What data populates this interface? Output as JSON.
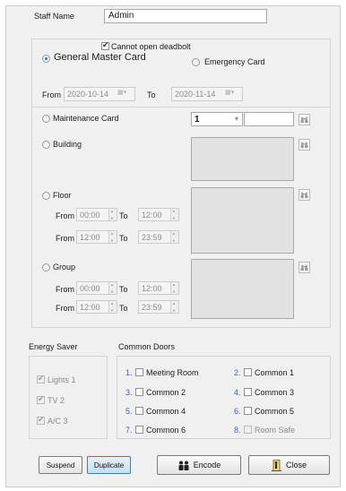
{
  "staff": {
    "label": "Staff Name",
    "value": "Admin"
  },
  "card_type": {
    "cannot_open_deadbolt": "Cannot open deadbolt",
    "general_master": "General Master Card",
    "emergency": "Emergency Card"
  },
  "validity": {
    "from_label": "From",
    "from_value": "2020-10-14",
    "to_label": "To",
    "to_value": "2020-11-14"
  },
  "maintenance": {
    "label": "Maintenance Card",
    "select_value": "1"
  },
  "building": {
    "label": "Building"
  },
  "floor": {
    "label": "Floor",
    "rows": [
      {
        "from_label": "From",
        "from": "00:00",
        "to_label": "To",
        "to": "12:00"
      },
      {
        "from_label": "From",
        "from": "12:00",
        "to_label": "To",
        "to": "23:59"
      }
    ]
  },
  "group": {
    "label": "Group",
    "rows": [
      {
        "from_label": "From",
        "from": "00:00",
        "to_label": "To",
        "to": "12:00"
      },
      {
        "from_label": "From",
        "from": "12:00",
        "to_label": "To",
        "to": "23:59"
      }
    ]
  },
  "energy_saver": {
    "title": "Energy Saver",
    "items": [
      {
        "label": "Lights 1"
      },
      {
        "label": "TV 2"
      },
      {
        "label": "A/C  3"
      }
    ]
  },
  "common_doors": {
    "title": "Common Doors",
    "items": [
      {
        "num": "1.",
        "label": "Meeting Room"
      },
      {
        "num": "2.",
        "label": "Common 1"
      },
      {
        "num": "3.",
        "label": "Common 2"
      },
      {
        "num": "4.",
        "label": "Common 3"
      },
      {
        "num": "5.",
        "label": "Common 4"
      },
      {
        "num": "6.",
        "label": "Common 5"
      },
      {
        "num": "7.",
        "label": "Common 6"
      },
      {
        "num": "8.",
        "label": "Room Safe"
      }
    ]
  },
  "buttons": {
    "suspend": "Suspend",
    "duplicate": "Duplicate",
    "encode": "Encode",
    "close": "Close"
  }
}
